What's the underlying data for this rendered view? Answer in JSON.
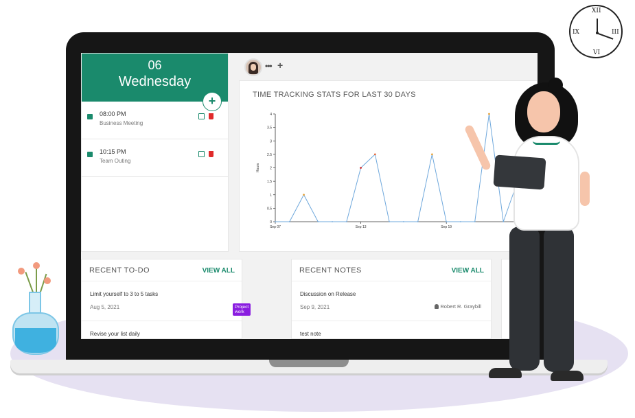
{
  "calendar": {
    "day": "06",
    "weekday": "Wednesday",
    "add_label": "+",
    "events": [
      {
        "time": "08:00 PM",
        "title": "Business Meeting"
      },
      {
        "time": "10:15 PM",
        "title": "Team Outing"
      }
    ]
  },
  "topbar": {
    "more_label": "•••",
    "add_label": "+"
  },
  "chart": {
    "title": "TIME TRACKING STATS FOR LAST 30 DAYS"
  },
  "chart_data": {
    "type": "line",
    "title": "TIME TRACKING STATS FOR LAST 30 DAYS",
    "ylabel": "Hours",
    "xlabel": "",
    "ylim": [
      0,
      4
    ],
    "yticks": [
      "0",
      "0.5",
      "1",
      "1.5",
      "2",
      "2.5",
      "3",
      "3.5",
      "4"
    ],
    "xtick_labels": [
      {
        "day": 0,
        "label": "Sep 07"
      },
      {
        "day": 6,
        "label": "Sep 13"
      },
      {
        "day": 12,
        "label": "Sep 19"
      }
    ],
    "x": [
      0,
      1,
      2,
      3,
      4,
      5,
      6,
      7,
      8,
      9,
      10,
      11,
      12,
      13,
      14,
      15,
      16,
      17
    ],
    "series": [
      {
        "values": [
          0,
          0,
          1,
          0,
          0,
          0,
          2,
          2.5,
          0,
          0,
          0,
          2.5,
          0,
          0,
          0,
          4,
          0,
          1.5
        ]
      }
    ],
    "grid": false
  },
  "todo": {
    "title": "RECENT TO-DO",
    "view_all": "VIEW ALL",
    "items": [
      {
        "title": "Limit yourself to 3 to 5 tasks",
        "date": "Aug 5, 2021",
        "tag": "Project work"
      },
      {
        "title": "Revise your list daily"
      }
    ]
  },
  "notes": {
    "title": "RECENT NOTES",
    "view_all": "VIEW ALL",
    "items": [
      {
        "title": "Discussion on Release",
        "date": "Sep 9, 2021",
        "author": "Robert R. Graybill"
      },
      {
        "title": "test note"
      }
    ]
  },
  "clock": {
    "numerals": [
      "XII",
      "III",
      "VI",
      "IX"
    ]
  },
  "colors": {
    "accent": "#1a8a6c",
    "tag": "#8a1de0",
    "delete": "#e02a2a",
    "chart_line": "#6fa8dc"
  }
}
